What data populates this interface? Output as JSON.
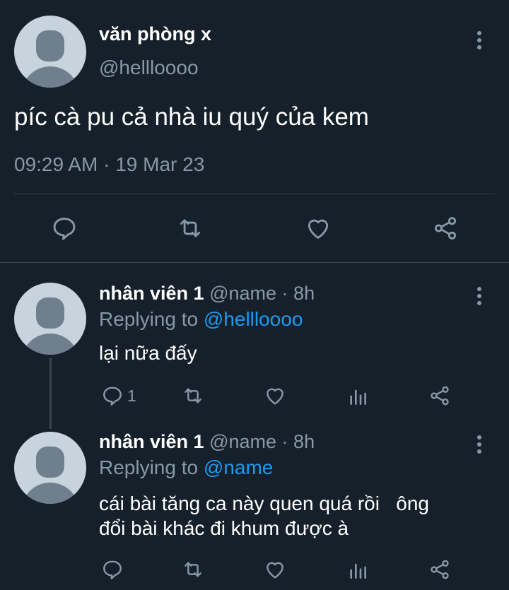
{
  "main_tweet": {
    "display_name": "văn phòng x",
    "handle": "@hellloooo",
    "text": "píc cà pu cả nhà iu quý của kem",
    "time": "09:29 AM",
    "separator": "·",
    "date": "19 Mar 23"
  },
  "replies": [
    {
      "display_name": "nhân viên 1",
      "handle": "@name",
      "separator": "·",
      "age": "8h",
      "replying_prefix": "Replying to",
      "replying_to": "@hellloooo",
      "text": "lại nữa đấy",
      "reply_count": "1"
    },
    {
      "display_name": "nhân viên 1",
      "handle": "@name",
      "separator": "·",
      "age": "8h",
      "replying_prefix": "Replying to",
      "replying_to": "@name",
      "text_line1": "cái bài tăng ca này quen quá rồi   ông",
      "text_line2": "đổi bài khác đi khum được à"
    }
  ],
  "colors": {
    "background": "#15202b",
    "text": "#ffffff",
    "muted": "#8899a6",
    "link": "#1d9bf0",
    "divider": "#38444d"
  },
  "icons": [
    "reply-icon",
    "retweet-icon",
    "like-icon",
    "share-icon",
    "analytics-icon",
    "more-icon"
  ]
}
